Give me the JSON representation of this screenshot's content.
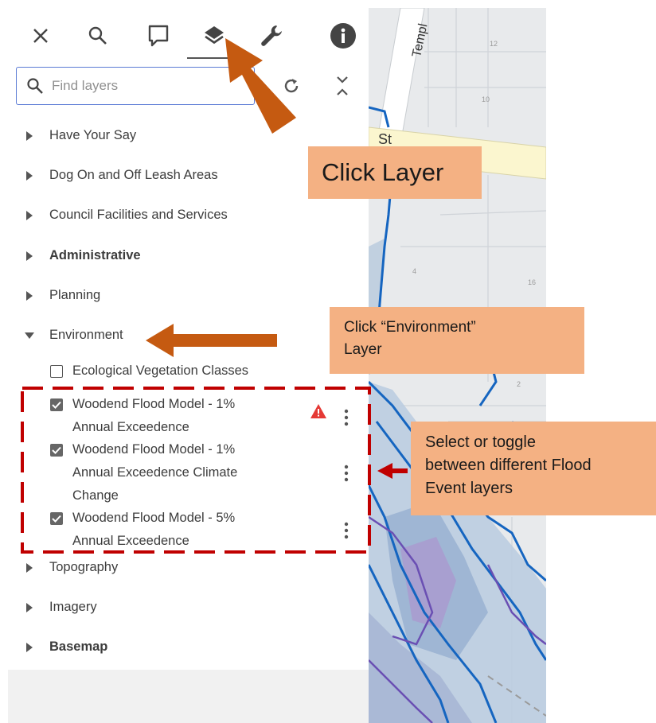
{
  "toolbar": {
    "tools": [
      "close-icon",
      "search-icon",
      "comment-icon",
      "layers-icon",
      "wrench-icon",
      "info-icon"
    ],
    "active_tool": "layers-icon"
  },
  "search": {
    "placeholder": "Find layers",
    "value": ""
  },
  "layer_groups": [
    {
      "label": "Have Your Say",
      "bold": false,
      "expanded": false
    },
    {
      "label": "Dog On and Off Leash Areas",
      "bold": false,
      "expanded": false
    },
    {
      "label": "Council Facilities and Services",
      "bold": false,
      "expanded": false
    },
    {
      "label": "Administrative",
      "bold": true,
      "expanded": false
    },
    {
      "label": "Planning",
      "bold": false,
      "expanded": false
    },
    {
      "label": "Environment",
      "bold": false,
      "expanded": true
    },
    {
      "label": "Topography",
      "bold": false,
      "expanded": false
    },
    {
      "label": "Imagery",
      "bold": false,
      "expanded": false
    },
    {
      "label": "Basemap",
      "bold": true,
      "expanded": false
    }
  ],
  "environment_layers": [
    {
      "lines": [
        "Ecological Vegetation Classes"
      ],
      "checked": false
    },
    {
      "lines": [
        "Woodend Flood Model - 1%",
        "Annual Exceedence"
      ],
      "checked": true,
      "warning": true
    },
    {
      "lines": [
        "Woodend Flood Model - 1%",
        "Annual Exceedence Climate",
        "Change"
      ],
      "checked": true
    },
    {
      "lines": [
        "Woodend Flood Model - 5%",
        "Annual Exceedence"
      ],
      "checked": true
    }
  ],
  "map": {
    "street_labels": [
      "Templ",
      "St"
    ],
    "parcel_numbers": [
      "12",
      "10",
      "16",
      "4",
      "2"
    ]
  },
  "annotations": {
    "click_layer": "Click Layer",
    "click_environment": [
      "Click “Environment”",
      "Layer"
    ],
    "select_toggle": [
      "Select or toggle",
      "between different Flood",
      "Event layers"
    ]
  },
  "colors": {
    "callout_fill": "#f4b183",
    "arrow": "#c55a11",
    "dashed_box": "#c00000",
    "search_border": "#5b7bd5",
    "warning": "#e53935",
    "flood_blue": "#1565c0",
    "flood_purple": "#6a4fb3"
  }
}
